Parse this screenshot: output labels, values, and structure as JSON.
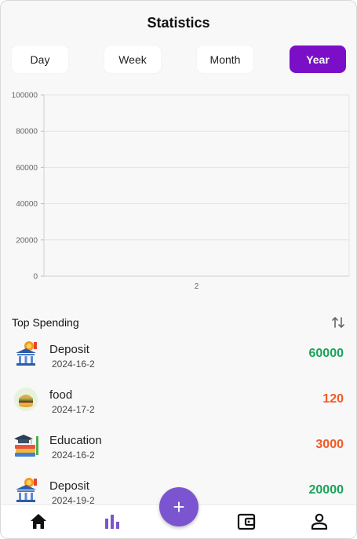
{
  "app": {
    "title": "Statistics"
  },
  "tabs": [
    {
      "label": "Day",
      "active": false
    },
    {
      "label": "Week",
      "active": false
    },
    {
      "label": "Month",
      "active": false
    },
    {
      "label": "Year",
      "active": true
    }
  ],
  "chart_data": {
    "type": "line",
    "title": "",
    "xlabel": "",
    "ylabel": "",
    "x_tick_labels": [
      "2"
    ],
    "y_tick_labels": [
      "0",
      "20000",
      "40000",
      "60000",
      "80000",
      "100000"
    ],
    "ylim": [
      0,
      100000
    ],
    "grid": true,
    "series": []
  },
  "top_spending": {
    "title": "Top Spending",
    "sort_icon": "sort-arrows-icon",
    "items": [
      {
        "name": "Deposit",
        "date": "2024-16-2",
        "amount": "60000",
        "type": "income",
        "icon": "bank-coin-icon"
      },
      {
        "name": "food",
        "date": "2024-17-2",
        "amount": "120",
        "type": "expense",
        "icon": "burger-icon"
      },
      {
        "name": "Education",
        "date": "2024-16-2",
        "amount": "3000",
        "type": "expense",
        "icon": "graduation-books-icon"
      },
      {
        "name": "Deposit",
        "date": "2024-19-2",
        "amount": "20000",
        "type": "income",
        "icon": "bank-coin-icon"
      }
    ]
  },
  "colors": {
    "accent": "#7a0fc7",
    "fab": "#7b55cf",
    "income": "#1aa35a",
    "expense": "#f05a28",
    "nav_active": "#7b55cf"
  },
  "nav": {
    "items": [
      "home-icon",
      "bar-chart-icon",
      "wallet-icon",
      "person-icon"
    ],
    "active": "bar-chart-icon",
    "fab_label": "+"
  }
}
